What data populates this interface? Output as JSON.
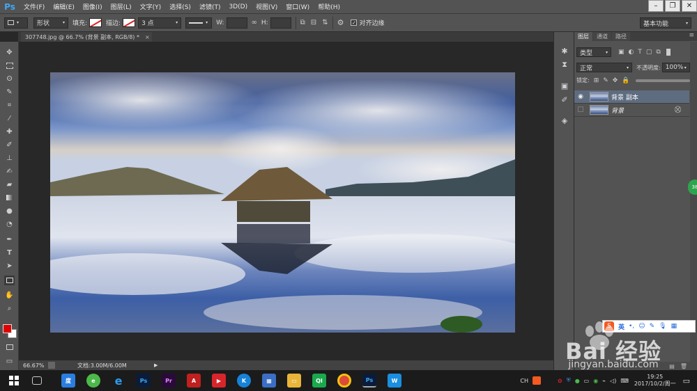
{
  "app": {
    "logo": "Ps"
  },
  "menu": [
    "文件(F)",
    "编辑(E)",
    "图像(I)",
    "图层(L)",
    "文字(Y)",
    "选择(S)",
    "滤镜(T)",
    "3D(D)",
    "视图(V)",
    "窗口(W)",
    "帮助(H)"
  ],
  "options": {
    "shape_mode": "形状",
    "fill_label": "填充:",
    "stroke_label": "描边:",
    "stroke_width": "3 点",
    "w_label": "W:",
    "h_label": "H:",
    "align_edges": "对齐边缘",
    "workspace": "基本功能"
  },
  "document": {
    "tab_title": "307748.jpg @ 66.7% (背景 副本, RGB/8) *",
    "zoom": "66.67%",
    "doc_size": "文档:3.00M/6.00M"
  },
  "layers_panel": {
    "tabs": [
      "图层",
      "通道",
      "路径"
    ],
    "filter_label": "类型",
    "blend_mode": "正常",
    "opacity_label": "不透明度:",
    "opacity_value": "100%",
    "lock_label": "锁定:",
    "layers": [
      {
        "name": "背景 副本",
        "visible": true,
        "selected": true,
        "locked": false
      },
      {
        "name": "背景",
        "visible": false,
        "selected": false,
        "locked": true
      }
    ]
  },
  "ime_bar": {
    "lang": "英"
  },
  "taskbar": {
    "ime_indicator": "CH",
    "time": "19:25",
    "date": "2017/10/2/周一"
  },
  "watermark": {
    "brand": "Bai 经验",
    "url": "jingyan.baidu.com"
  },
  "side_badge": "38",
  "colors": {
    "foreground": "#e00000",
    "background": "#ffffff",
    "accent": "#3fa8f5"
  }
}
